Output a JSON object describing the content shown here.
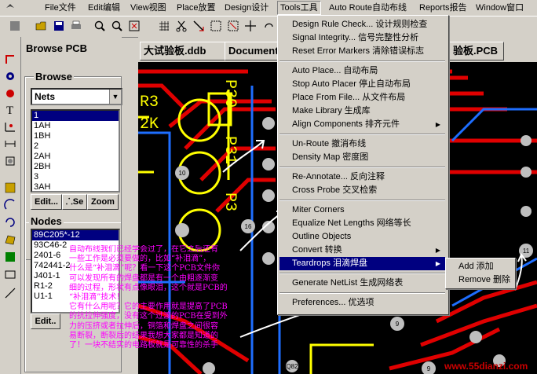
{
  "menubar": {
    "items": [
      "File文件",
      "Edit编辑",
      "View视图",
      "Place放置",
      "Design设计",
      "Tools工具",
      "Auto Route自动布线",
      "Reports报告",
      "Window窗口"
    ]
  },
  "browse_panel": {
    "tab_label": "Browse PCB",
    "browse_group_label": "Browse",
    "browse_type": "Nets",
    "nets": [
      "1",
      "1AH",
      "1BH",
      "2",
      "2AH",
      "2BH",
      "3",
      "3AH"
    ],
    "selected_net": "1",
    "edit_label": "Edit...",
    "select_label": "Se",
    "zoom_label": "Zoom",
    "nodes_group_label": "Nodes",
    "nodes": [
      "89C205*-12",
      "93C46-2",
      "2401-6",
      "742441-2",
      "J401-1",
      "R1-2",
      "U1-1"
    ],
    "selected_node": "89C205*-12",
    "edit2_label": "Edit.."
  },
  "documents": {
    "tabs": [
      "大试验板.ddb",
      "Documents",
      "验板.PCB"
    ]
  },
  "pcb": {
    "labels": [
      "P30",
      "P31",
      "P3",
      "R3",
      "2K"
    ],
    "pad_numbers": [
      "10",
      "16",
      "11",
      "9",
      "9",
      "Q82"
    ]
  },
  "tools_menu": {
    "items": [
      {
        "label": "Design Rule Check... 设计规则检查"
      },
      {
        "label": "Signal Integrity... 信号完整性分析"
      },
      {
        "label": "Reset Error Markers 清除错误标志"
      },
      {
        "label": "Auto Place... 自动布局"
      },
      {
        "label": "Stop Auto Placer 停止自动布局"
      },
      {
        "label": "Place From File... 从文件布局"
      },
      {
        "label": "Make Library 生成库"
      },
      {
        "label": "Align Components 排齐元件"
      },
      {
        "label": "Un-Route 撤消布线"
      },
      {
        "label": "Density Map 密度图"
      },
      {
        "label": "Re-Annotate... 反向注释"
      },
      {
        "label": "Cross Probe 交叉检索"
      },
      {
        "label": "Miter Corners"
      },
      {
        "label": "Equalize Net Lengths 网络等长"
      },
      {
        "label": "Outline Objects"
      },
      {
        "label": "Convert 转换"
      },
      {
        "label": "Teardrops 泪滴焊盘"
      },
      {
        "label": "Generate NetList 生成网络表"
      },
      {
        "label": "Preferences... 优选项"
      }
    ],
    "highlighted": "Teardrops 泪滴焊盘"
  },
  "teardrops_submenu": {
    "items": [
      "Add 添加",
      "Remove 删除"
    ]
  },
  "annotation": {
    "lines": [
      "自动布线我们已经学会过了，在它之后还有",
      "一些工作是必须要做的，比如“补泪滴”，",
      "什么是“补泪滴”呢？看一下这个PCB文件你",
      "可以发现所有的焊盘都是有一个由粗逐渐变",
      "细的过程，形状有点像眼泪，这个就是PCB的",
      "“补泪滴”技术！",
      "它有什么用呢？它的主要作用就是提高了PCB",
      "的抗拉伸强度，没有这个过渡的PCB在受到外",
      "力的压挤或者拉伸后，铜箔和焊盘之间很容",
      "易断裂，断裂后的结果我想大家都是知道的",
      "了！一块不结实的电路板就是可靠性的杀手"
    ]
  },
  "watermark": "www.55dianzi.com",
  "colors": {
    "menu_highlight": "#000080",
    "annotation_text": "#ff00ff",
    "pcb_background": "#000000",
    "track_red": "#e00000",
    "pad_yellow": "#ffff00",
    "watermark": "#cc0000"
  },
  "icons": [
    "app-icon",
    "open-folder-icon",
    "save-icon",
    "print-icon",
    "zoom-in-icon",
    "zoom-out-icon",
    "cut-icon",
    "select-icon",
    "place-icon",
    "route-icon",
    "via-icon",
    "text-icon",
    "component-icon"
  ]
}
